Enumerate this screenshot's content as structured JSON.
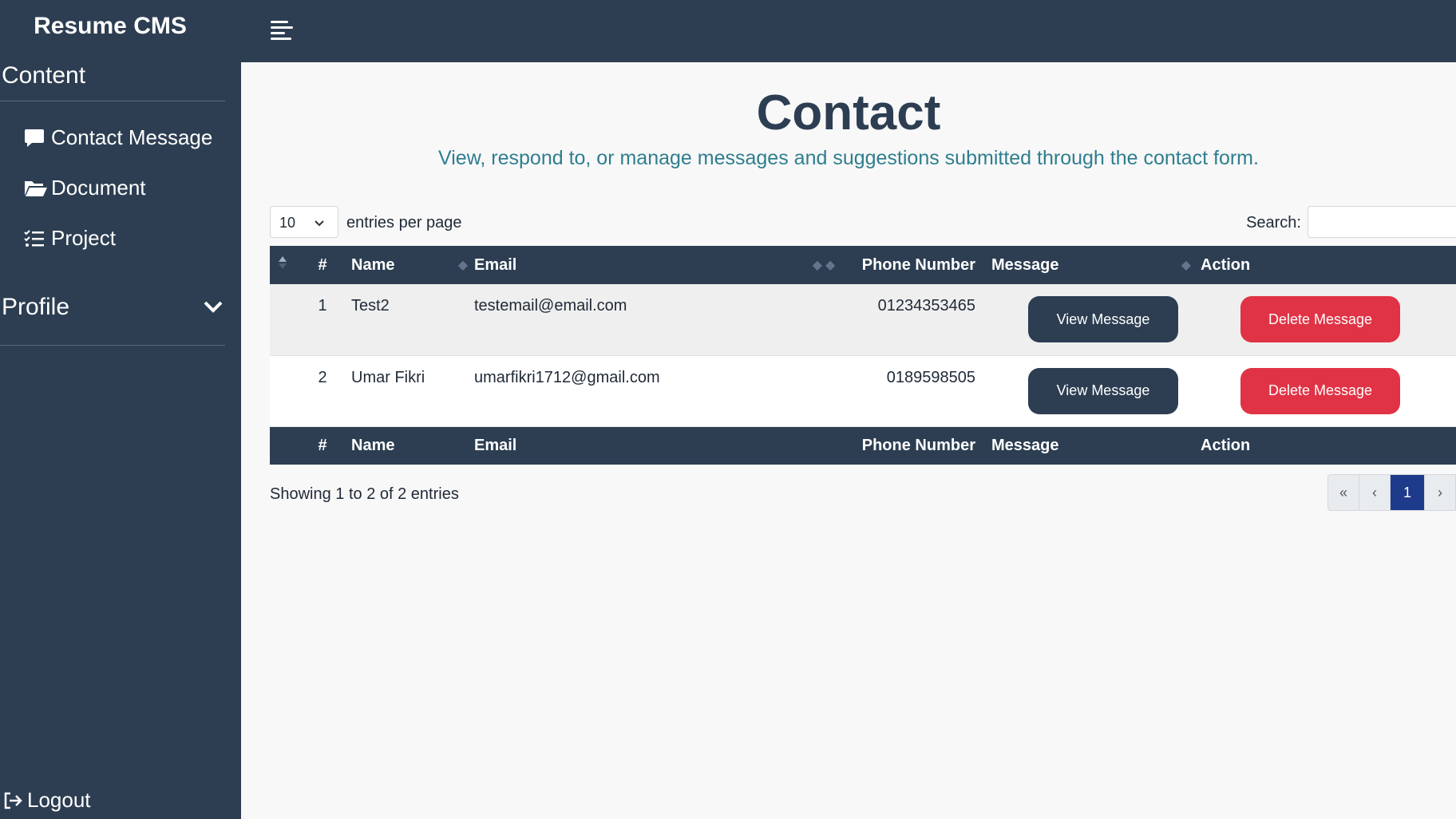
{
  "app": {
    "brand": "Resume CMS"
  },
  "sidebar": {
    "section_title": "Content",
    "items": [
      {
        "label": "Contact Message",
        "icon": "comment-icon"
      },
      {
        "label": "Document",
        "icon": "folder-open-icon"
      },
      {
        "label": "Project",
        "icon": "list-check-icon"
      }
    ],
    "profile_label": "Profile",
    "logout_label": "Logout"
  },
  "page": {
    "title": "Contact",
    "subtitle": "View, respond to, or manage messages and suggestions submitted through the contact form."
  },
  "table_controls": {
    "per_page_value": "10",
    "per_page_label": "entries per page",
    "search_label": "Search:",
    "search_value": ""
  },
  "table": {
    "columns": [
      "#",
      "Name",
      "Email",
      "Phone Number",
      "Message",
      "Action"
    ],
    "rows": [
      {
        "num": "1",
        "name": "Test2",
        "email": "testemail@email.com",
        "phone": "01234353465",
        "view_label": "View Message",
        "delete_label": "Delete Message"
      },
      {
        "num": "2",
        "name": "Umar Fikri",
        "email": "umarfikri1712@gmail.com",
        "phone": "0189598505",
        "view_label": "View Message",
        "delete_label": "Delete Message"
      }
    ]
  },
  "footer": {
    "info": "Showing 1 to 2 of 2 entries",
    "pager": {
      "first": "«",
      "prev": "‹",
      "current": "1",
      "next": "›"
    }
  },
  "colors": {
    "primary": "#2d3e52",
    "danger": "#e03345",
    "subtitle": "#2f7e8f",
    "active_page": "#1e3a8a"
  }
}
